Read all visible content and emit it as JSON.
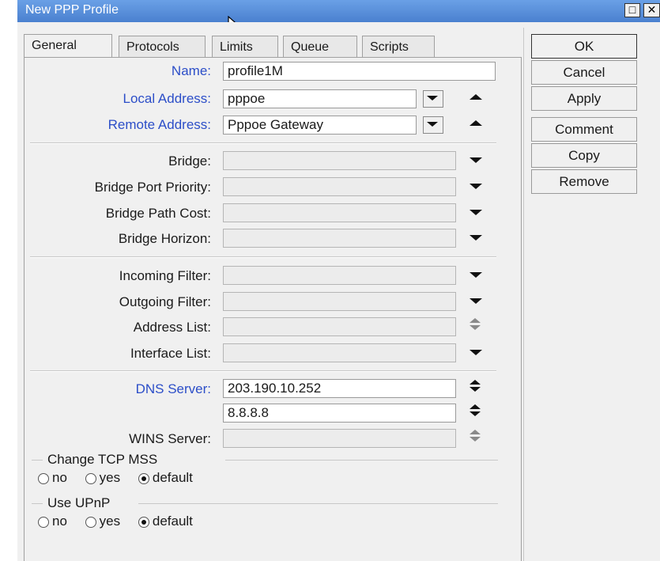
{
  "window": {
    "title": "New PPP Profile",
    "restore_glyph": "□",
    "close_glyph": "✕"
  },
  "tabs": [
    {
      "label": "General"
    },
    {
      "label": "Protocols"
    },
    {
      "label": "Limits"
    },
    {
      "label": "Queue"
    },
    {
      "label": "Scripts"
    }
  ],
  "form": {
    "name": {
      "label": "Name:",
      "value": "profile1M"
    },
    "local_address": {
      "label": "Local Address:",
      "value": "pppoe"
    },
    "remote_address": {
      "label": "Remote Address:",
      "value": "Pppoe Gateway"
    },
    "bridge": {
      "label": "Bridge:",
      "value": ""
    },
    "bridge_port_priority": {
      "label": "Bridge Port Priority:",
      "value": ""
    },
    "bridge_path_cost": {
      "label": "Bridge Path Cost:",
      "value": ""
    },
    "bridge_horizon": {
      "label": "Bridge Horizon:",
      "value": ""
    },
    "incoming_filter": {
      "label": "Incoming Filter:",
      "value": ""
    },
    "outgoing_filter": {
      "label": "Outgoing Filter:",
      "value": ""
    },
    "address_list": {
      "label": "Address List:",
      "value": ""
    },
    "interface_list": {
      "label": "Interface List:",
      "value": ""
    },
    "dns_server": {
      "label": "DNS Server:",
      "value1": "203.190.10.252",
      "value2": "8.8.8.8"
    },
    "wins_server": {
      "label": "WINS Server:",
      "value": ""
    }
  },
  "change_tcp_mss": {
    "title": "Change TCP MSS",
    "options": [
      "no",
      "yes",
      "default"
    ],
    "selected": "default"
  },
  "use_upnp": {
    "title": "Use UPnP",
    "options": [
      "no",
      "yes",
      "default"
    ],
    "selected": "default"
  },
  "buttons": {
    "ok": "OK",
    "cancel": "Cancel",
    "apply": "Apply",
    "comment": "Comment",
    "copy": "Copy",
    "remove": "Remove"
  },
  "colors": {
    "titlebar": "#4a80cf",
    "highlight_label": "#2c4ec8",
    "background": "#f0f0f0"
  }
}
